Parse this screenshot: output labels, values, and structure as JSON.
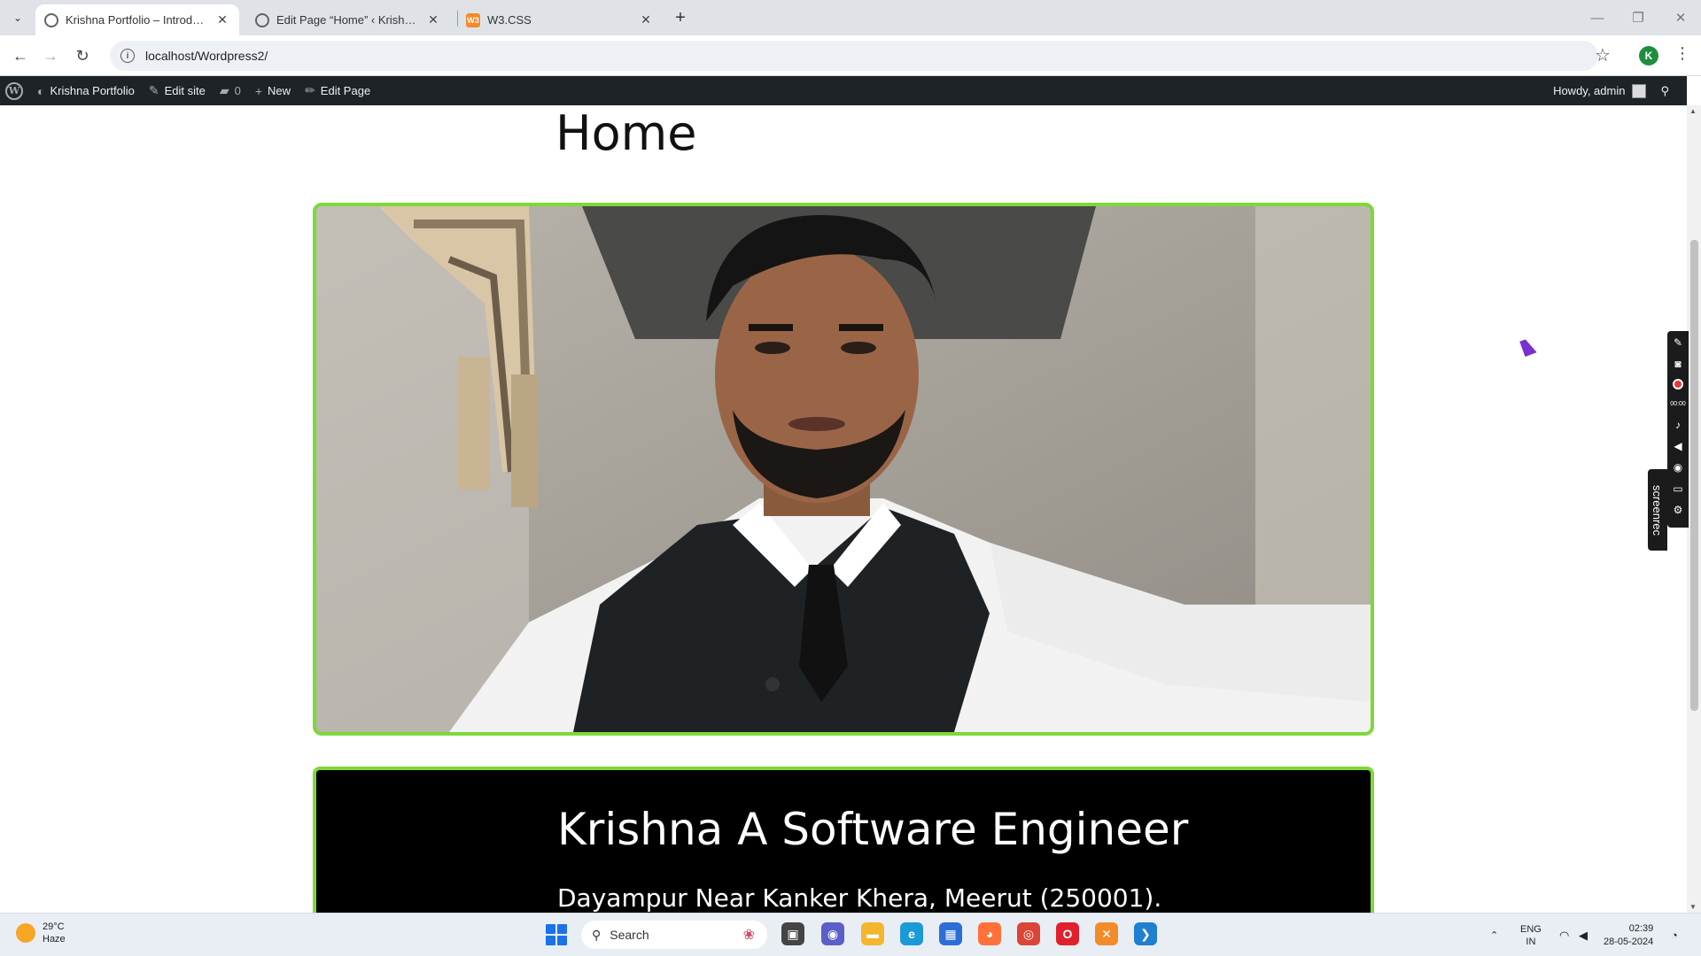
{
  "browser": {
    "tabs": [
      {
        "title": "Krishna Portfolio – Introduction",
        "active": true
      },
      {
        "title": "Edit Page “Home” ‹ Krishna Portfolio",
        "active": false
      },
      {
        "title": "W3.CSS",
        "active": false
      }
    ],
    "favicon_w3": "W3",
    "new_tab": "+",
    "url": "localhost/Wordpress2/",
    "profile_initial": "K"
  },
  "adminbar": {
    "site_name": "Krishna Portfolio",
    "edit_site": "Edit site",
    "comments_count": "0",
    "new": "New",
    "edit_page": "Edit Page",
    "greeting": "Howdy, admin"
  },
  "page": {
    "title": "Home",
    "bio_name": "Krishna A Software Engineer",
    "bio_address": "Dayampur Near Kanker Khera, Meerut (250001)."
  },
  "screenrec": {
    "label": "screenrec",
    "timer": "00:00"
  },
  "taskbar": {
    "temperature": "29°C",
    "condition": "Haze",
    "search_placeholder": "Search",
    "lang_top": "ENG",
    "lang_bottom": "IN",
    "time": "02:39",
    "date": "28-05-2024"
  },
  "colors": {
    "accent_green": "#7ed83a",
    "adminbar": "#1d2327"
  }
}
